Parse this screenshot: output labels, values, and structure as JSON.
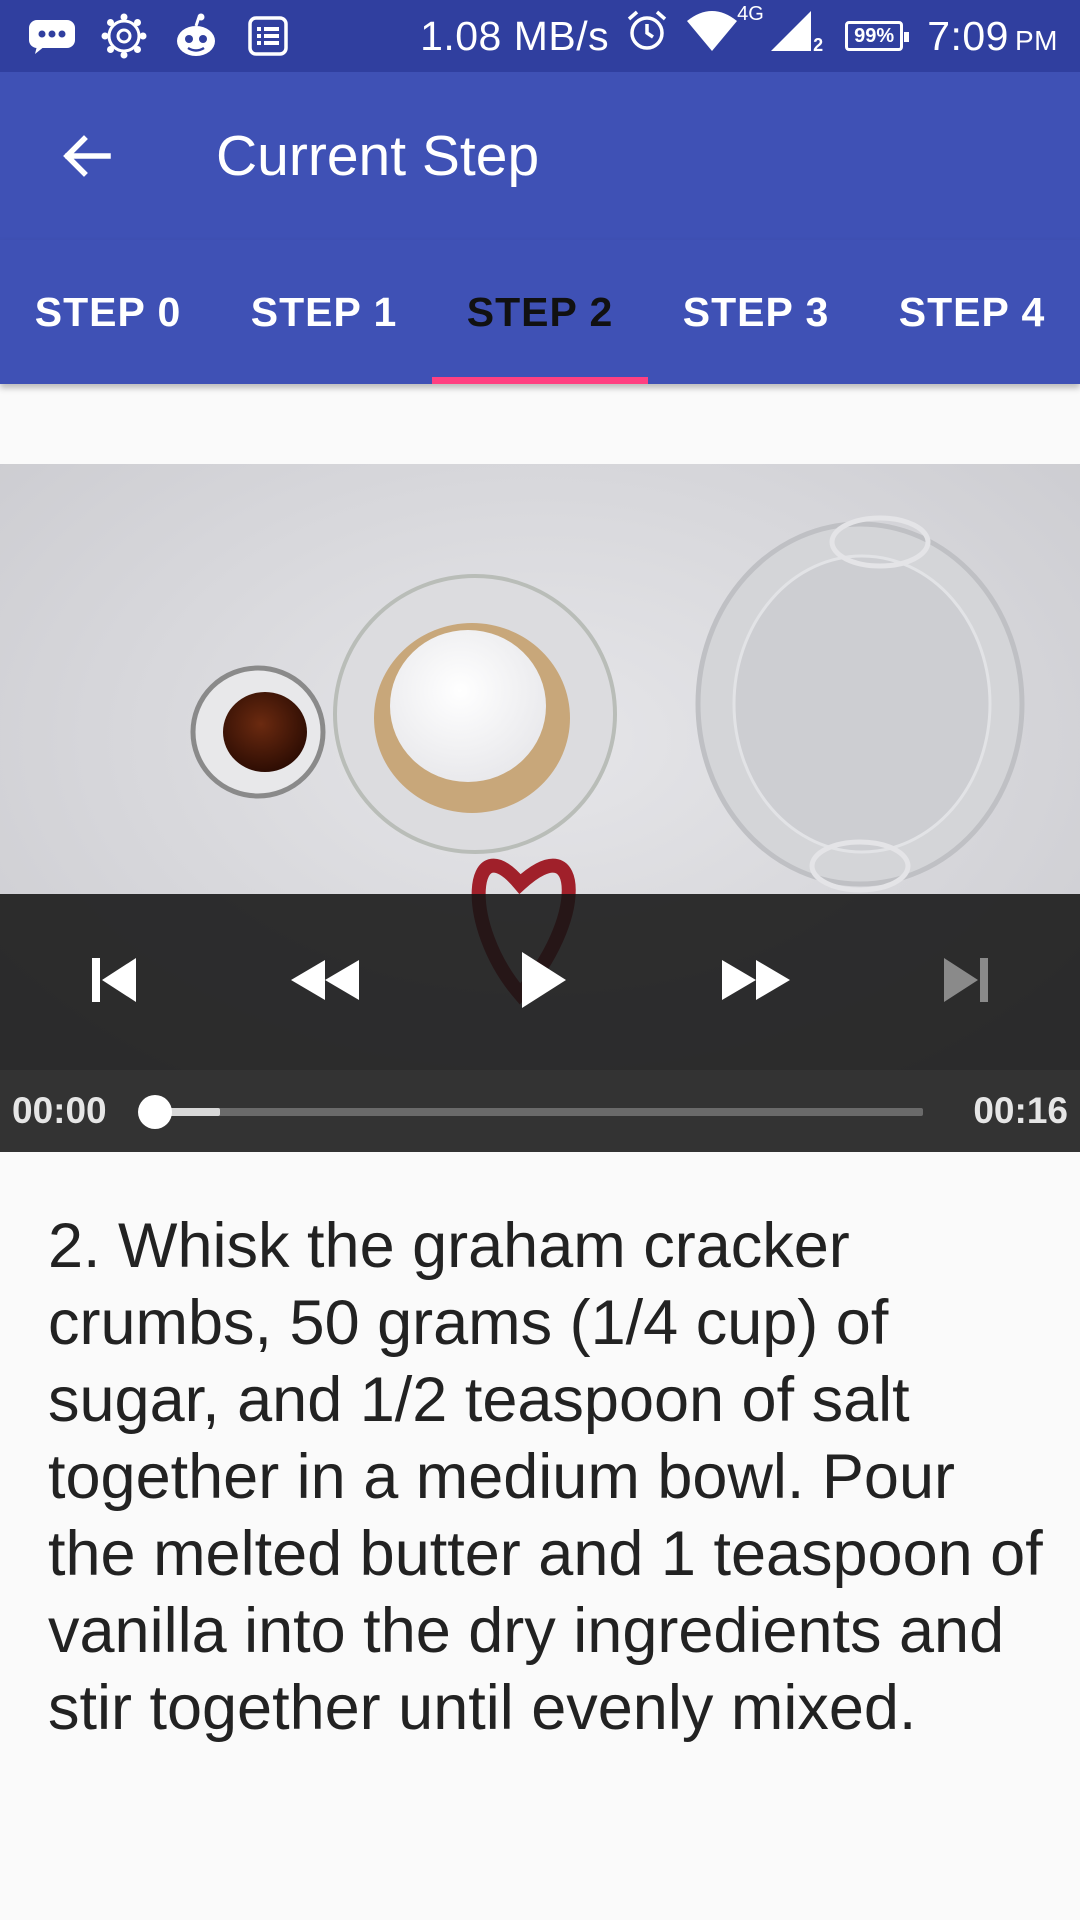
{
  "status_bar": {
    "speed": "1.08 MB/s",
    "network_label": "4G",
    "sim_slot": "2",
    "battery": "99%",
    "time": "7:09",
    "time_suffix": "PM",
    "icons": [
      "chat-bubble-icon",
      "settings-gear-icon",
      "alien-icon",
      "list-icon",
      "alarm-icon",
      "wifi-icon",
      "signal-icon",
      "battery-icon"
    ]
  },
  "app_bar": {
    "title": "Current Step",
    "back_icon": "arrow-back-icon"
  },
  "tabs": [
    {
      "label": "STEP 0"
    },
    {
      "label": "STEP 1"
    },
    {
      "label": "STEP 2"
    },
    {
      "label": "STEP 3"
    },
    {
      "label": "STEP 4"
    }
  ],
  "selected_tab": 2,
  "colors": {
    "primary": "#3f51b5",
    "primary_dark": "#303f9f",
    "accent": "#ff4081"
  },
  "player": {
    "controls": [
      "skip-previous-icon",
      "rewind-icon",
      "play-icon",
      "fast-forward-icon",
      "skip-next-icon"
    ],
    "position": "00:00",
    "duration": "00:16",
    "progress_fraction": 0.0,
    "buffered_fraction": 0.085
  },
  "step": {
    "description": "2. Whisk the graham cracker crumbs, 50 grams (1/4 cup) of sugar, and 1/2 teaspoon of salt together in a medium bowl. Pour the melted butter and 1 teaspoon of vanilla into the dry ingredients and stir together until evenly mixed."
  }
}
